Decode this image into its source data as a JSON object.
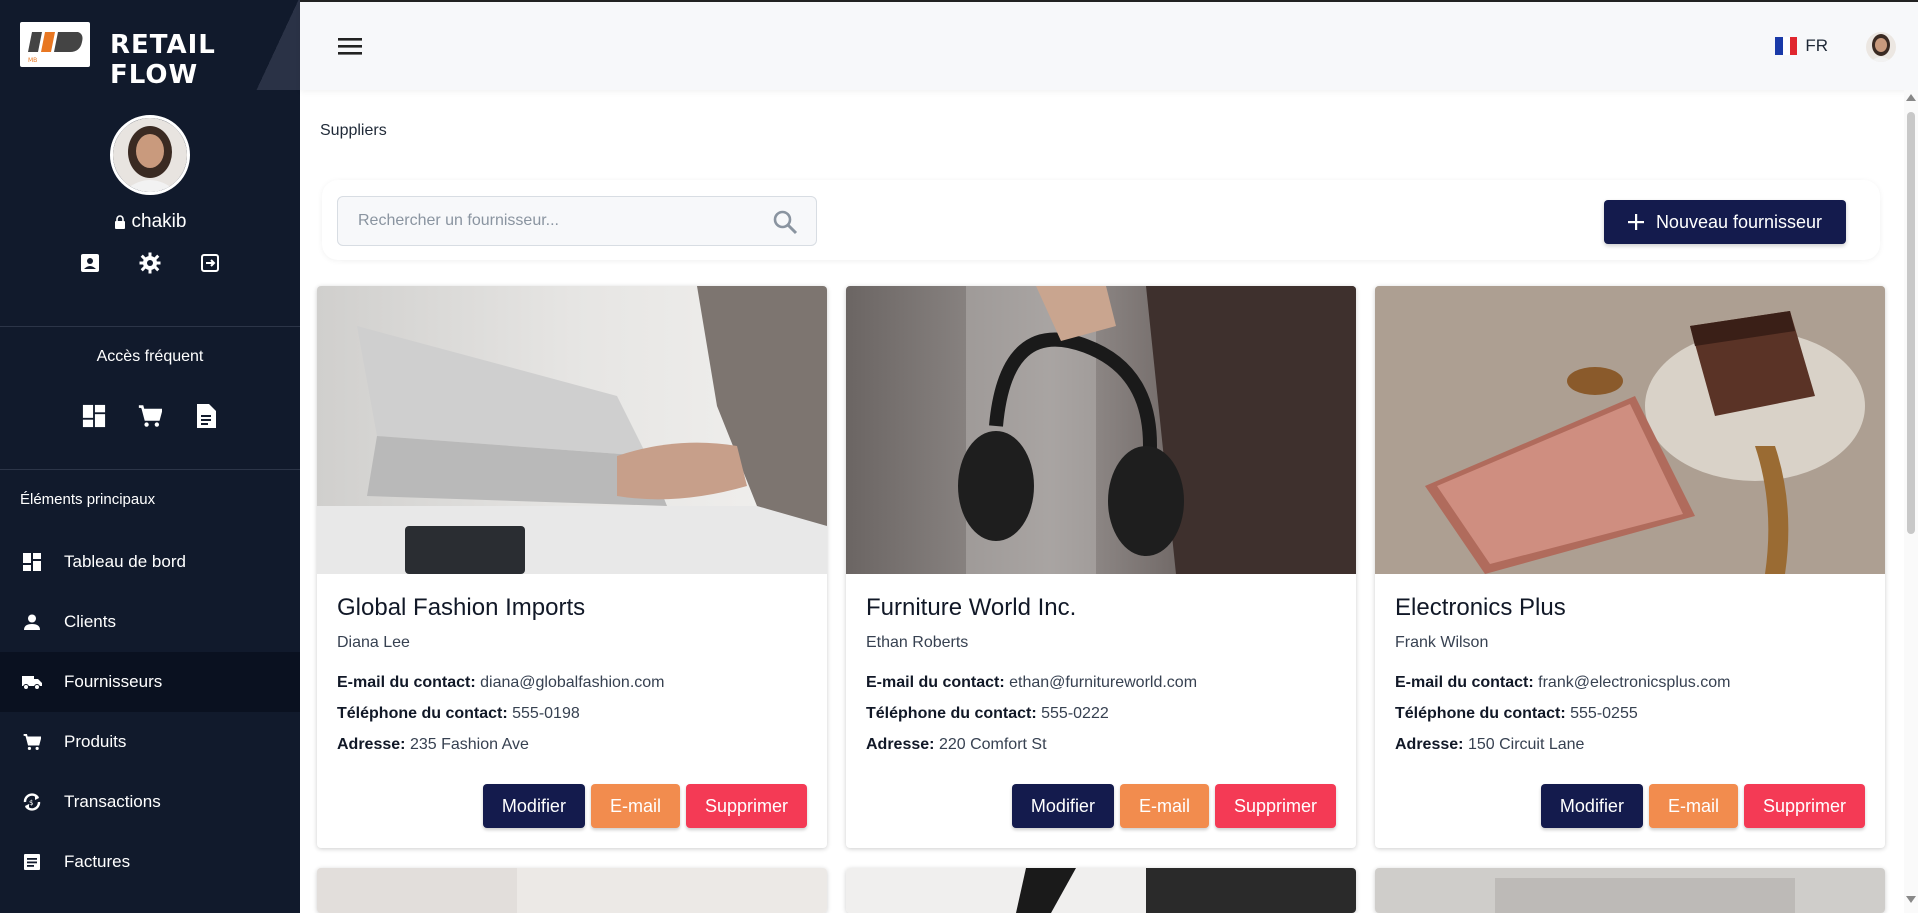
{
  "brand": {
    "title": "RETAIL FLOW",
    "logo_text": "MB"
  },
  "profile": {
    "username": "chakib"
  },
  "sidebar": {
    "frequent_title": "Accès fréquent",
    "main_title": "Éléments principaux",
    "items": [
      {
        "label": "Tableau de bord",
        "icon": "dashboard-icon"
      },
      {
        "label": "Clients",
        "icon": "person-icon"
      },
      {
        "label": "Fournisseurs",
        "icon": "truck-icon",
        "active": true
      },
      {
        "label": "Produits",
        "icon": "cart-icon"
      },
      {
        "label": "Transactions",
        "icon": "exchange-icon"
      },
      {
        "label": "Factures",
        "icon": "invoice-icon"
      }
    ]
  },
  "topbar": {
    "lang": "FR"
  },
  "breadcrumb": "Suppliers",
  "search": {
    "placeholder": "Rechercher un fournisseur..."
  },
  "new_supplier_label": "Nouveau fournisseur",
  "labels": {
    "email": "E-mail du contact:",
    "phone": "Téléphone du contact:",
    "address": "Adresse:",
    "edit": "Modifier",
    "mail": "E-mail",
    "delete": "Supprimer"
  },
  "suppliers": [
    {
      "name": "Global Fashion Imports",
      "contact": "Diana Lee",
      "email": "diana@globalfashion.com",
      "phone": "555-0198",
      "address": "235 Fashion Ave"
    },
    {
      "name": "Furniture World Inc.",
      "contact": "Ethan Roberts",
      "email": "ethan@furnitureworld.com",
      "phone": "555-0222",
      "address": "220 Comfort St"
    },
    {
      "name": "Electronics Plus",
      "contact": "Frank Wilson",
      "email": "frank@electronicsplus.com",
      "phone": "555-0255",
      "address": "150 Circuit Lane"
    }
  ],
  "colors": {
    "sidebar_bg": "#111a2c",
    "primary": "#141b4d",
    "mail": "#f28c4e",
    "danger": "#f43a55"
  }
}
